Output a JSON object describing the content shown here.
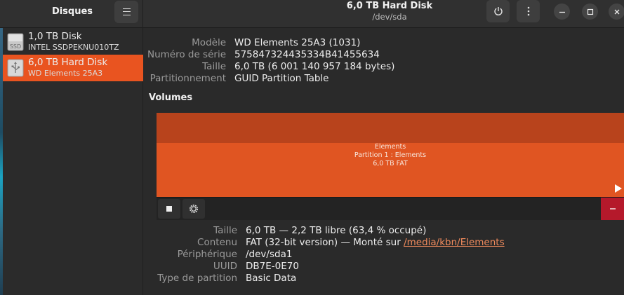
{
  "app": {
    "title": "Disques"
  },
  "window": {
    "title": "6,0 TB Hard Disk",
    "subtitle": "/dev/sda"
  },
  "sidebar": {
    "items": [
      {
        "name": "1,0 TB Disk",
        "sub": "INTEL SSDPEKNU010TZ",
        "icon": "ssd-icon",
        "icon_text": "SSD",
        "selected": false
      },
      {
        "name": "6,0 TB Hard Disk",
        "sub": "WD Elements 25A3",
        "icon": "usb-drive-icon",
        "selected": true
      }
    ]
  },
  "drive": {
    "model_label": "Modèle",
    "model": "WD Elements 25A3 (1031)",
    "serial_label": "Numéro de série",
    "serial": "575847324435334B41455634",
    "size_label": "Taille",
    "size": "6,0 TB (6 001 140 957 184 bytes)",
    "partitioning_label": "Partitionnement",
    "partitioning": "GUID Partition Table"
  },
  "volumes": {
    "title": "Volumes",
    "block": {
      "line1": "Elements",
      "line2": "Partition 1 : Elements",
      "line3": "6,0 TB FAT"
    }
  },
  "volume_details": {
    "size_label": "Taille",
    "size": "6,0 TB — 2,2 TB libre (63,4 % occupé)",
    "content_label": "Contenu",
    "content_prefix": "FAT (32-bit version) — Monté sur ",
    "content_link": "/media/kbn/Elements",
    "device_label": "Périphérique",
    "device": "/dev/sda1",
    "uuid_label": "UUID",
    "uuid": "DB7E-0E70",
    "ptype_label": "Type de partition",
    "ptype": "Basic Data"
  },
  "colors": {
    "accent": "#e95420",
    "volume": "#e05522",
    "delete": "#b5192b"
  }
}
